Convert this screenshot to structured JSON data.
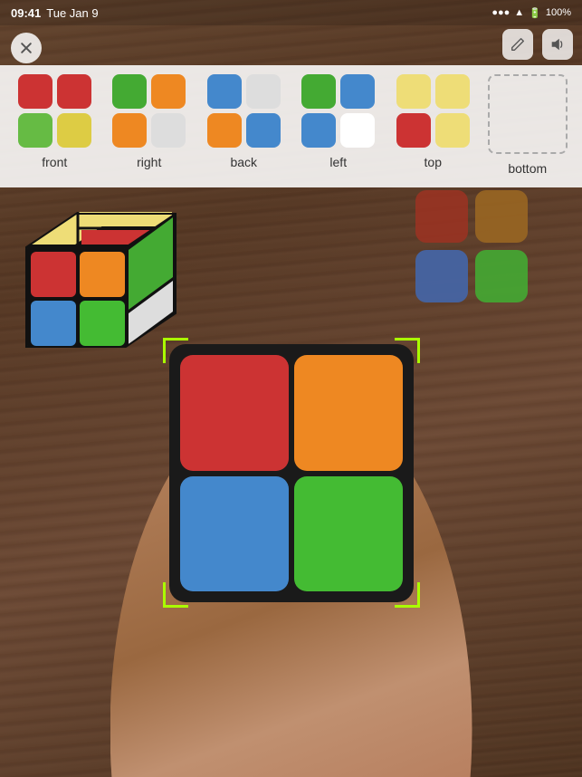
{
  "statusBar": {
    "time": "09:41",
    "date": "Tue Jan 9",
    "battery": "100%",
    "signal": "●●●●",
    "wifi": "wifi"
  },
  "faces": [
    {
      "id": "front",
      "label": "front",
      "colors": [
        "#cc3333",
        "#cc3333",
        "#66bb44",
        "#ddcc44"
      ]
    },
    {
      "id": "right",
      "label": "right",
      "colors": [
        "#44aa33",
        "#ee8822",
        "#ee8822",
        "#dddddd"
      ]
    },
    {
      "id": "back",
      "label": "back",
      "colors": [
        "#4488cc",
        "#dddddd",
        "#ee8822",
        "#4488cc"
      ]
    },
    {
      "id": "left",
      "label": "left",
      "colors": [
        "#44aa33",
        "#4488cc",
        "#4488cc",
        "#ffffff"
      ]
    },
    {
      "id": "top",
      "label": "top",
      "colors": [
        "#eedd77",
        "#eedd77",
        "#cc3333",
        "#eedd77"
      ]
    },
    {
      "id": "bottom",
      "label": "bottom",
      "colors": []
    }
  ],
  "detectedColors": [
    [
      "#993322",
      "#996622"
    ],
    [
      "#4466aa",
      "#44aa33"
    ]
  ],
  "physicalCube": {
    "cells": [
      "#cc3333",
      "#ee8822",
      "#4488cc",
      "#44bb33"
    ]
  },
  "cubeButtons": {
    "close": "×",
    "edit": "✎",
    "sound": "🔊"
  }
}
